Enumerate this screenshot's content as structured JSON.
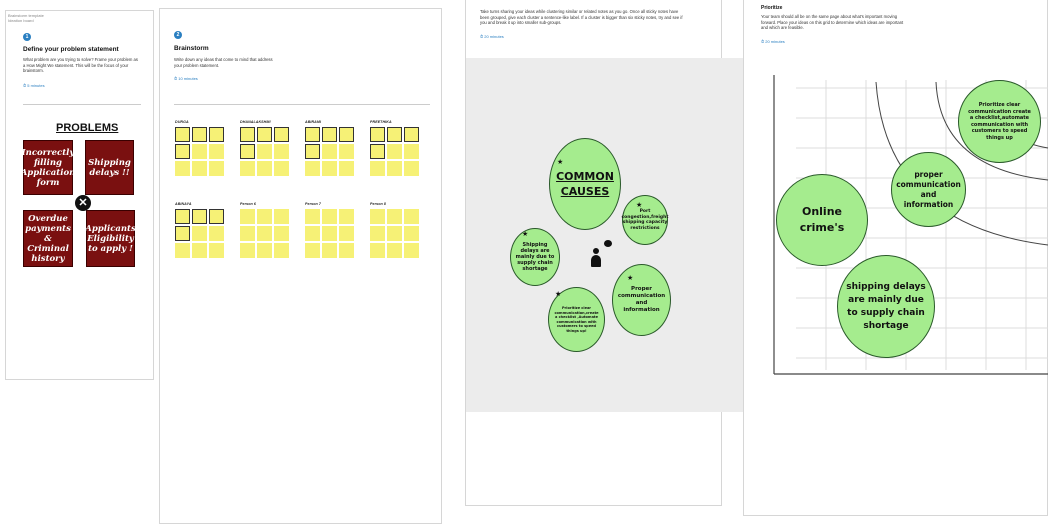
{
  "panel1": {
    "meta_line1": "Brainstorm template",
    "meta_line2": "Ideation board",
    "step": "1",
    "title": "Define your problem statement",
    "desc": "What problem are you trying to solve? Frame your problem as a How Might We statement. This will be the focus of your brainstorm.",
    "time": "5 minutes",
    "problems_heading": "PROBLEMS",
    "cards": [
      "Incorrectly filling Application form",
      "Shipping delays !!",
      "Overdue payments & Criminal history",
      "Applicants Eligibility to apply !"
    ],
    "close_glyph": "✕"
  },
  "panel2": {
    "step": "2",
    "title": "Brainstorm",
    "desc": "Write down any ideas that come to mind that address your problem statement.",
    "time": "10 minutes",
    "people": [
      "DURGA",
      "DHANALAKSHMI",
      "ABIRAMI",
      "PREETHIKA",
      "ABINAYA",
      "Person 6",
      "Person 7",
      "Person 8"
    ]
  },
  "panel3": {
    "desc": "Take turns sharing your ideas while clustering similar or related notes as you go. Once all sticky notes have been grouped, give each cluster a sentence-like label. If a cluster is bigger than six sticky notes, try and see if you and break it up into smaller sub-groups.",
    "time": "20 minutes",
    "common_causes": "COMMON CAUSES",
    "bubbles": {
      "port": "Port congestion,freight shipping capacity restrictions",
      "shipping": "Shipping delays are mainly due to supply chain shortage",
      "proper": "Proper communication and information",
      "prioritize": "Prioritize clear communication,create a checklist ,Automate communication with customers to speed things up!"
    }
  },
  "panel4": {
    "title": "Prioritize",
    "desc": "Your team should all be on the same page about what's important moving forward. Place your ideas on this grid to determine which ideas are important and which are feasible.",
    "time": "20 minutes",
    "bubbles": {
      "online": "Online crime's",
      "proper": "proper communication and information",
      "shipping": "shipping delays are mainly due to supply chain shortage",
      "prioritize": "Prioritize clear communication create a checklist,automate communication with customers to speed things up"
    }
  }
}
